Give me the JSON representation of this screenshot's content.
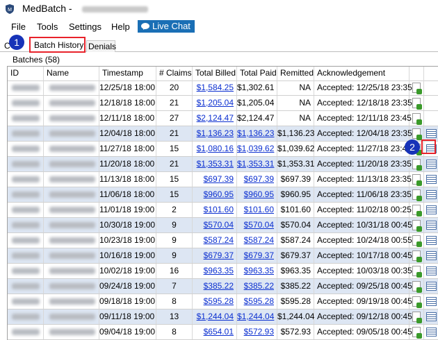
{
  "window": {
    "title": "MedBatch -"
  },
  "menu": {
    "file": "File",
    "tools": "Tools",
    "settings": "Settings",
    "help": "Help",
    "live_chat": "Live Chat"
  },
  "tabs": {
    "partial": "C",
    "batch_history": "Batch History",
    "denials": "Denials"
  },
  "badges": {
    "one": "1",
    "two": "2"
  },
  "group": {
    "label": "Batches (58)"
  },
  "columns": {
    "id": "ID",
    "name": "Name",
    "timestamp": "Timestamp",
    "claims": "# Claims",
    "total_billed": "Total Billed",
    "total_paid": "Total Paid",
    "remitted": "Remitted",
    "ack": "Acknowledgement"
  },
  "colors": {
    "accent": "#1a6fb5",
    "highlight": "#e8222a",
    "badge": "#1733b8",
    "row_alt": "#dde6f3",
    "link": "#0b2fd0"
  },
  "rows": [
    {
      "timestamp": "12/25/18 18:00",
      "claims": "20",
      "billed": "$1,584.25",
      "paid": "$1,302.61",
      "remitted": "NA",
      "ack": "Accepted: 12/25/18 23:35",
      "paid_link": false,
      "table_icon": false,
      "alt": false
    },
    {
      "timestamp": "12/18/18 18:00",
      "claims": "21",
      "billed": "$1,205.04",
      "paid": "$1,205.04",
      "remitted": "NA",
      "ack": "Accepted: 12/18/18 23:35",
      "paid_link": false,
      "table_icon": false,
      "alt": false
    },
    {
      "timestamp": "12/11/18 18:00",
      "claims": "27",
      "billed": "$2,124.47",
      "paid": "$2,124.47",
      "remitted": "NA",
      "ack": "Accepted: 12/11/18 23:45",
      "paid_link": false,
      "table_icon": false,
      "alt": false
    },
    {
      "timestamp": "12/04/18 18:00",
      "claims": "21",
      "billed": "$1,136.23",
      "paid": "$1,136.23",
      "remitted": "$1,136.23",
      "ack": "Accepted: 12/04/18 23:35",
      "paid_link": true,
      "table_icon": true,
      "alt": true
    },
    {
      "timestamp": "11/27/18 18:00",
      "claims": "15",
      "billed": "$1,080.16",
      "paid": "$1,039.62",
      "remitted": "$1,039.62",
      "ack": "Accepted: 11/27/18 23:45",
      "paid_link": true,
      "table_icon": true,
      "alt": false
    },
    {
      "timestamp": "11/20/18 18:00",
      "claims": "21",
      "billed": "$1,353.31",
      "paid": "$1,353.31",
      "remitted": "$1,353.31",
      "ack": "Accepted: 11/20/18 23:35",
      "paid_link": true,
      "table_icon": true,
      "alt": true
    },
    {
      "timestamp": "11/13/18 18:00",
      "claims": "15",
      "billed": "$697.39",
      "paid": "$697.39",
      "remitted": "$697.39",
      "ack": "Accepted: 11/13/18 23:35",
      "paid_link": true,
      "table_icon": true,
      "alt": false
    },
    {
      "timestamp": "11/06/18 18:00",
      "claims": "15",
      "billed": "$960.95",
      "paid": "$960.95",
      "remitted": "$960.95",
      "ack": "Accepted: 11/06/18 23:35",
      "paid_link": true,
      "table_icon": true,
      "alt": true
    },
    {
      "timestamp": "11/01/18 19:00",
      "claims": "2",
      "billed": "$101.60",
      "paid": "$101.60",
      "remitted": "$101.60",
      "ack": "Accepted: 11/02/18 00:25",
      "paid_link": true,
      "table_icon": true,
      "alt": false
    },
    {
      "timestamp": "10/30/18 19:00",
      "claims": "9",
      "billed": "$570.04",
      "paid": "$570.04",
      "remitted": "$570.04",
      "ack": "Accepted: 10/31/18 00:45",
      "paid_link": true,
      "table_icon": true,
      "alt": true
    },
    {
      "timestamp": "10/23/18 19:00",
      "claims": "9",
      "billed": "$587.24",
      "paid": "$587.24",
      "remitted": "$587.24",
      "ack": "Accepted: 10/24/18 00:55",
      "paid_link": true,
      "table_icon": true,
      "alt": false
    },
    {
      "timestamp": "10/16/18 19:00",
      "claims": "9",
      "billed": "$679.37",
      "paid": "$679.37",
      "remitted": "$679.37",
      "ack": "Accepted: 10/17/18 00:45",
      "paid_link": true,
      "table_icon": true,
      "alt": true
    },
    {
      "timestamp": "10/02/18 19:00",
      "claims": "16",
      "billed": "$963.35",
      "paid": "$963.35",
      "remitted": "$963.35",
      "ack": "Accepted: 10/03/18 00:35",
      "paid_link": true,
      "table_icon": true,
      "alt": false
    },
    {
      "timestamp": "09/24/18 19:00",
      "claims": "7",
      "billed": "$385.22",
      "paid": "$385.22",
      "remitted": "$385.22",
      "ack": "Accepted: 09/25/18 00:45",
      "paid_link": true,
      "table_icon": true,
      "alt": true
    },
    {
      "timestamp": "09/18/18 19:00",
      "claims": "8",
      "billed": "$595.28",
      "paid": "$595.28",
      "remitted": "$595.28",
      "ack": "Accepted: 09/19/18 00:45",
      "paid_link": true,
      "table_icon": true,
      "alt": false
    },
    {
      "timestamp": "09/11/18 19:00",
      "claims": "13",
      "billed": "$1,244.04",
      "paid": "$1,244.04",
      "remitted": "$1,244.04",
      "ack": "Accepted: 09/12/18 00:45",
      "paid_link": true,
      "table_icon": true,
      "alt": true
    },
    {
      "timestamp": "09/04/18 19:00",
      "claims": "8",
      "billed": "$654.01",
      "paid": "$572.93",
      "remitted": "$572.93",
      "ack": "Accepted: 09/05/18 00:45",
      "paid_link": true,
      "table_icon": true,
      "alt": false
    }
  ]
}
